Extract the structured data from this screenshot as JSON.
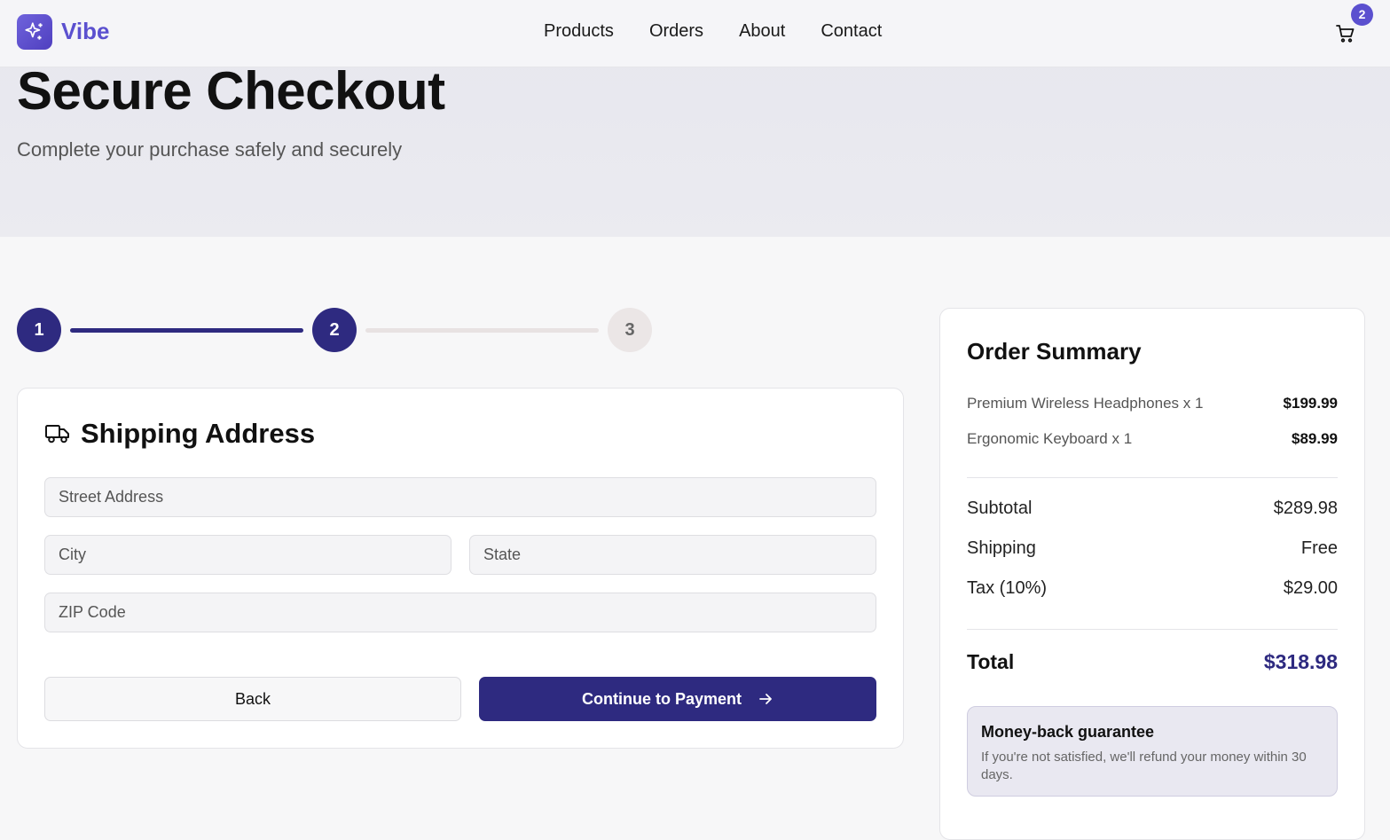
{
  "brand": {
    "name": "Vibe",
    "color": "#5b50cf"
  },
  "nav": {
    "links": [
      "Products",
      "Orders",
      "About",
      "Contact"
    ],
    "cart_count": "2"
  },
  "hero": {
    "title": "Secure Checkout",
    "subtitle": "Complete your purchase safely and securely"
  },
  "steps": {
    "labels": [
      "1",
      "2",
      "3"
    ],
    "current": 2,
    "active_color": "#2e2a80"
  },
  "shipping": {
    "title": "Shipping Address",
    "street_placeholder": "Street Address",
    "city_placeholder": "City",
    "state_placeholder": "State",
    "zip_placeholder": "ZIP Code",
    "back_label": "Back",
    "continue_label": "Continue to Payment"
  },
  "summary": {
    "title": "Order Summary",
    "items": [
      {
        "name": "Premium Wireless Headphones x 1",
        "price": "$199.99"
      },
      {
        "name": "Ergonomic Keyboard x 1",
        "price": "$89.99"
      }
    ],
    "subtotal_label": "Subtotal",
    "subtotal": "$289.98",
    "shipping_label": "Shipping",
    "shipping": "Free",
    "tax_label": "Tax (10%)",
    "tax": "$29.00",
    "total_label": "Total",
    "total": "$318.98",
    "guarantee_title": "Money-back guarantee",
    "guarantee_text": "If you're not satisfied, we'll refund your money within 30 days."
  }
}
